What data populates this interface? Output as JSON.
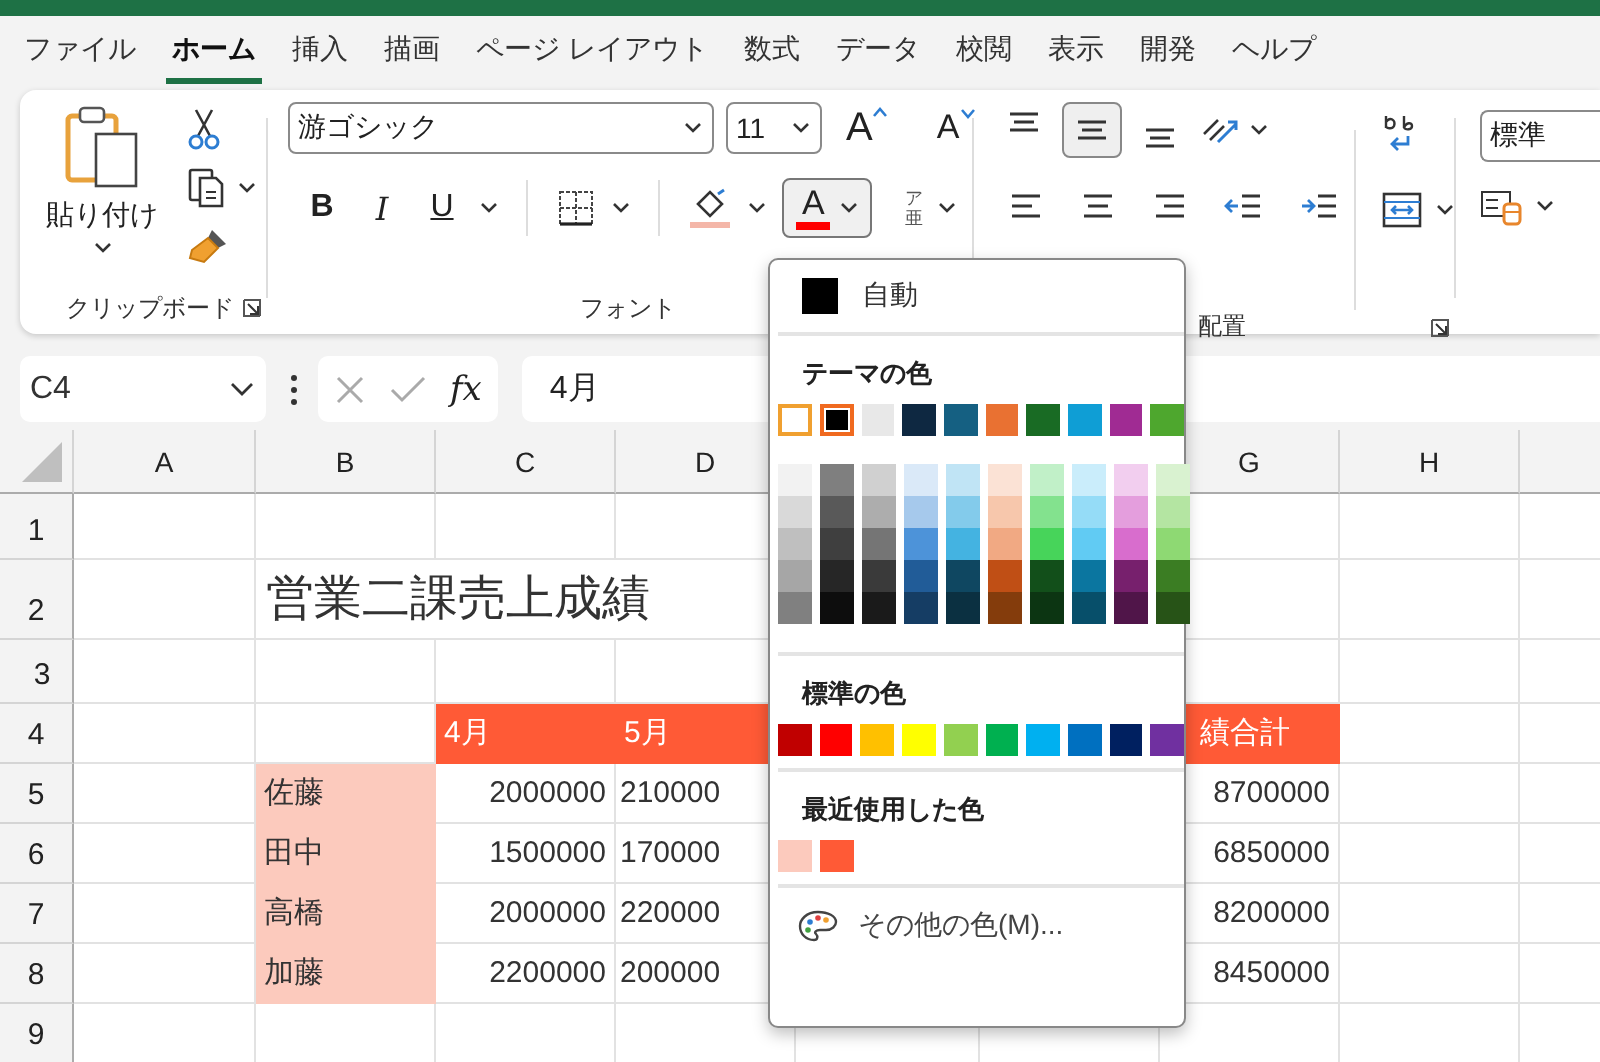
{
  "menu_tabs": [
    {
      "label": "ファイル",
      "selected": false
    },
    {
      "label": "ホーム",
      "selected": true
    },
    {
      "label": "挿入",
      "selected": false
    },
    {
      "label": "描画",
      "selected": false
    },
    {
      "label": "ページ レイアウト",
      "selected": false
    },
    {
      "label": "数式",
      "selected": false
    },
    {
      "label": "データ",
      "selected": false
    },
    {
      "label": "校閲",
      "selected": false
    },
    {
      "label": "表示",
      "selected": false
    },
    {
      "label": "開発",
      "selected": false
    },
    {
      "label": "ヘルプ",
      "selected": false
    }
  ],
  "ribbon": {
    "clipboard": {
      "paste_label": "貼り付け",
      "group_label": "クリップボード"
    },
    "font": {
      "font_name": "游ゴシック",
      "font_size": "11",
      "grow": "A",
      "shrink": "A",
      "bold": "B",
      "italic": "I",
      "underline": "U",
      "font_color_button": {
        "label": "A",
        "color": "#ff0000",
        "expanded": true
      },
      "fill_color_button": {
        "color": "#f4b6a8"
      },
      "phonetic_top": "ア",
      "phonetic_bottom": "亜",
      "group_label": "フォント"
    },
    "alignment": {
      "vertical": [
        {
          "selected": false
        },
        {
          "selected": true
        },
        {
          "selected": false
        }
      ],
      "group_label": "配置"
    },
    "number": {
      "format": "標準"
    }
  },
  "formula_bar": {
    "name_box": "C4",
    "fx": "fx",
    "formula": "4月"
  },
  "sheet": {
    "columns": [
      "A",
      "B",
      "C",
      "D",
      null,
      null,
      "G",
      "H"
    ],
    "rows": [
      {
        "header": "1",
        "cells": [
          null,
          null,
          null,
          null,
          null,
          null,
          null,
          null
        ]
      },
      {
        "header": "2",
        "cells": [
          null,
          {
            "text": "営業二課売上成績",
            "kind": "title"
          },
          null,
          null,
          null,
          null,
          null,
          null
        ]
      },
      {
        "header": "3",
        "cells": [
          null,
          null,
          null,
          null,
          null,
          null,
          null,
          null
        ]
      },
      {
        "header": "4",
        "cells": [
          null,
          null,
          {
            "text": "4月",
            "kind": "text",
            "color": "#ff5a36"
          },
          {
            "text": "5月",
            "kind": "text",
            "color": "#ff5a36"
          },
          null,
          null,
          {
            "text": "績合計",
            "kind": "text",
            "color": "#ff5a36"
          },
          null
        ]
      },
      {
        "header": "5",
        "cells": [
          null,
          {
            "text": "佐藤",
            "kind": "text",
            "color": "#fccabd"
          },
          {
            "text": "2000000",
            "kind": "number"
          },
          {
            "text": "210000",
            "kind": "cut"
          },
          null,
          null,
          {
            "text": "8700000",
            "kind": "number"
          },
          null
        ]
      },
      {
        "header": "6",
        "cells": [
          null,
          {
            "text": "田中",
            "kind": "text",
            "color": "#fccabd"
          },
          {
            "text": "1500000",
            "kind": "number"
          },
          {
            "text": "170000",
            "kind": "cut"
          },
          null,
          null,
          {
            "text": "6850000",
            "kind": "number"
          },
          null
        ]
      },
      {
        "header": "7",
        "cells": [
          null,
          {
            "text": "高橋",
            "kind": "text",
            "color": "#fccabd"
          },
          {
            "text": "2000000",
            "kind": "number"
          },
          {
            "text": "220000",
            "kind": "cut"
          },
          null,
          null,
          {
            "text": "8200000",
            "kind": "number"
          },
          null
        ]
      },
      {
        "header": "8",
        "cells": [
          null,
          {
            "text": "加藤",
            "kind": "text",
            "color": "#fccabd"
          },
          {
            "text": "2200000",
            "kind": "number"
          },
          {
            "text": "200000",
            "kind": "cut"
          },
          null,
          null,
          {
            "text": "8450000",
            "kind": "number"
          },
          null
        ]
      },
      {
        "header": "9",
        "cells": [
          null,
          null,
          null,
          null,
          null,
          null,
          null,
          null
        ]
      }
    ]
  },
  "color_menu": {
    "automatic": {
      "label": "自動",
      "color": "#000000"
    },
    "theme_heading": "テーマの色",
    "theme_colors": [
      {
        "color": "#ffffff",
        "selected": false,
        "hovered": true
      },
      {
        "color": "#000000",
        "selected": true,
        "hovered": false
      },
      {
        "color": "#e8e8e8",
        "selected": false,
        "hovered": false
      },
      {
        "color": "#0e2841",
        "selected": false,
        "hovered": false
      },
      {
        "color": "#156082",
        "selected": false,
        "hovered": false
      },
      {
        "color": "#e97132",
        "selected": false,
        "hovered": false
      },
      {
        "color": "#196b24",
        "selected": false,
        "hovered": false
      },
      {
        "color": "#0f9ed5",
        "selected": false,
        "hovered": false
      },
      {
        "color": "#a02b93",
        "selected": false,
        "hovered": false
      },
      {
        "color": "#4ea72e",
        "selected": false,
        "hovered": false
      }
    ],
    "theme_shades": [
      {
        "shades": [
          {
            "color": "#f2f2f2"
          },
          {
            "color": "#d9d9d9"
          },
          {
            "color": "#bfbfbf"
          },
          {
            "color": "#a6a6a6"
          },
          {
            "color": "#808080"
          }
        ]
      },
      {
        "shades": [
          {
            "color": "#7f7f7f"
          },
          {
            "color": "#595959"
          },
          {
            "color": "#3f3f3f"
          },
          {
            "color": "#262626"
          },
          {
            "color": "#0d0d0d"
          }
        ]
      },
      {
        "shades": [
          {
            "color": "#d0d0d0"
          },
          {
            "color": "#adadad"
          },
          {
            "color": "#757575"
          },
          {
            "color": "#3a3a3a"
          },
          {
            "color": "#1a1a1a"
          }
        ]
      },
      {
        "shades": [
          {
            "color": "#dae9f8"
          },
          {
            "color": "#a6c9ec"
          },
          {
            "color": "#4d93d9"
          },
          {
            "color": "#215c98"
          },
          {
            "color": "#153d64"
          }
        ]
      },
      {
        "shades": [
          {
            "color": "#c0e4f5"
          },
          {
            "color": "#83cbeb"
          },
          {
            "color": "#44b3e1"
          },
          {
            "color": "#0f4761"
          },
          {
            "color": "#0b3041"
          }
        ]
      },
      {
        "shades": [
          {
            "color": "#fbe2d5"
          },
          {
            "color": "#f7c7ac"
          },
          {
            "color": "#f1a983"
          },
          {
            "color": "#c04f15"
          },
          {
            "color": "#843c0c"
          }
        ]
      },
      {
        "shades": [
          {
            "color": "#c1f0c8"
          },
          {
            "color": "#83e28e"
          },
          {
            "color": "#47d45a"
          },
          {
            "color": "#124f1a"
          },
          {
            "color": "#0c3512"
          }
        ]
      },
      {
        "shades": [
          {
            "color": "#caedfb"
          },
          {
            "color": "#95dcf7"
          },
          {
            "color": "#61cbf3"
          },
          {
            "color": "#0b76a0"
          },
          {
            "color": "#074f6a"
          }
        ]
      },
      {
        "shades": [
          {
            "color": "#f2ceef"
          },
          {
            "color": "#e49edd"
          },
          {
            "color": "#d86dcd"
          },
          {
            "color": "#77206d"
          },
          {
            "color": "#501549"
          }
        ]
      },
      {
        "shades": [
          {
            "color": "#d9f2d0"
          },
          {
            "color": "#b4e5a2"
          },
          {
            "color": "#8ed973"
          },
          {
            "color": "#3b7d23"
          },
          {
            "color": "#275317"
          }
        ]
      }
    ],
    "standard_heading": "標準の色",
    "standard_colors": [
      {
        "color": "#c00000"
      },
      {
        "color": "#ff0000"
      },
      {
        "color": "#ffc000"
      },
      {
        "color": "#ffff00"
      },
      {
        "color": "#92d050"
      },
      {
        "color": "#00b050"
      },
      {
        "color": "#00b0f0"
      },
      {
        "color": "#0070c0"
      },
      {
        "color": "#002060"
      },
      {
        "color": "#7030a0"
      }
    ],
    "recent_heading": "最近使用した色",
    "recent_colors": [
      {
        "color": "#fccabd"
      },
      {
        "color": "#ff5a36"
      }
    ],
    "more_colors": "その他の色(M)..."
  }
}
